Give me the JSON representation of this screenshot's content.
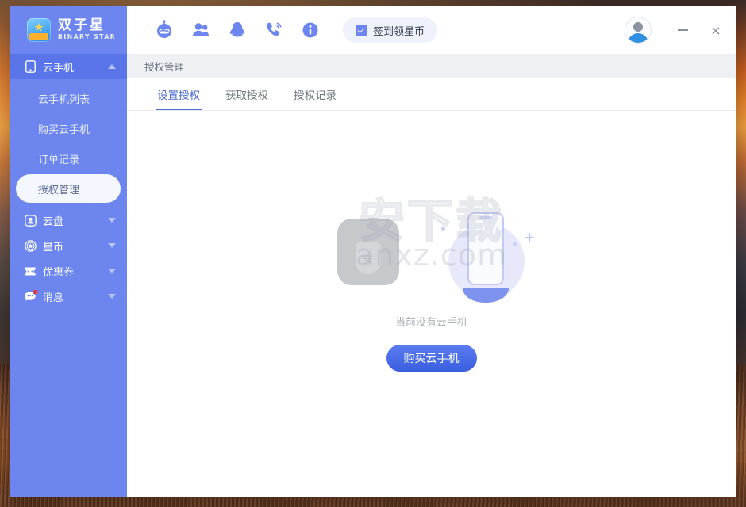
{
  "window": {
    "brand_cn": "双子星",
    "brand_en": "BINARY STAR",
    "minimize_label": "—",
    "close_label": "×"
  },
  "toolbar": {
    "icons": [
      {
        "name": "robot-assistant-icon",
        "label": "智能助手"
      },
      {
        "name": "people-icon",
        "label": "用户群"
      },
      {
        "name": "qq-penguin-icon",
        "label": "QQ客服"
      },
      {
        "name": "phone-support-icon",
        "label": "电话客服"
      },
      {
        "name": "info-icon",
        "label": "关于"
      }
    ],
    "signin_label": "签到领星币"
  },
  "sidebar": {
    "groups": [
      {
        "label": "云手机",
        "icon": "mobile-phone-icon",
        "expanded": true,
        "chevron": "up",
        "badge": false,
        "items": [
          {
            "label": "云手机列表",
            "selected": false
          },
          {
            "label": "购买云手机",
            "selected": false
          },
          {
            "label": "订单记录",
            "selected": false
          },
          {
            "label": "授权管理",
            "selected": true
          }
        ]
      },
      {
        "label": "云盘",
        "icon": "cloud-disk-icon",
        "expanded": false,
        "chevron": "down",
        "badge": false,
        "items": []
      },
      {
        "label": "星币",
        "icon": "star-coin-icon",
        "expanded": false,
        "chevron": "down",
        "badge": false,
        "items": []
      },
      {
        "label": "优惠券",
        "icon": "coupon-ticket-icon",
        "expanded": false,
        "chevron": "down",
        "badge": false,
        "items": []
      },
      {
        "label": "消息",
        "icon": "message-icon",
        "expanded": false,
        "chevron": "down",
        "badge": true,
        "items": []
      }
    ]
  },
  "main": {
    "breadcrumb": "授权管理",
    "tabs": [
      {
        "label": "设置授权",
        "active": true
      },
      {
        "label": "获取授权",
        "active": false
      },
      {
        "label": "授权记录",
        "active": false
      }
    ],
    "empty_state": {
      "shield_glyph": "安",
      "message": "当前没有云手机",
      "action_label": "购买云手机"
    },
    "watermark": {
      "cn": "安下载",
      "en": "anxz.com"
    }
  },
  "colors": {
    "sidebar": "#6d85ee",
    "sidebar_active": "#5a75ea",
    "accent": "#4a6ad4",
    "button": "#3a5fe0",
    "badge": "#f4342c",
    "breadcrumb_bg": "#eef0f3"
  }
}
